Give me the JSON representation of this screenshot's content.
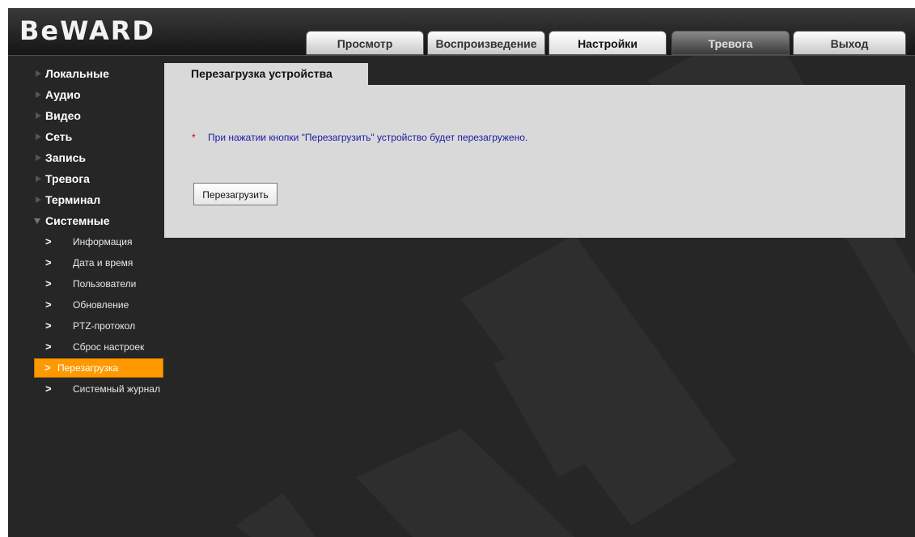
{
  "brand": {
    "logo": "BeWARD"
  },
  "tabs": [
    {
      "label": "Просмотр"
    },
    {
      "label": "Воспроизведение"
    },
    {
      "label": "Настройки",
      "active": true
    },
    {
      "label": "Тревога"
    },
    {
      "label": "Выход"
    }
  ],
  "sidebar": {
    "categories": [
      {
        "label": "Локальные"
      },
      {
        "label": "Аудио"
      },
      {
        "label": "Видео"
      },
      {
        "label": "Сеть"
      },
      {
        "label": "Запись"
      },
      {
        "label": "Тревога"
      },
      {
        "label": "Терминал"
      },
      {
        "label": "Системные",
        "expanded": true
      }
    ],
    "system_items": [
      {
        "label": "Информация"
      },
      {
        "label": "Дата и время"
      },
      {
        "label": "Пользователи"
      },
      {
        "label": "Обновление"
      },
      {
        "label": "PTZ-протокол"
      },
      {
        "label": "Сброс настроек"
      },
      {
        "label": "Перезагрузка",
        "active": true
      },
      {
        "label": "Системный журнал"
      }
    ]
  },
  "content": {
    "tab_title": "Перезагрузка устройства",
    "note_marker": "*",
    "note": "При нажатии кнопки \"Перезагрузить\" устройство будет перезагружено.",
    "reboot_button": "Перезагрузить"
  },
  "colors": {
    "background": "#262626",
    "panel": "#d9d9d9",
    "accent_active": "#ff9900",
    "note_text": "#1a1aa8",
    "required_marker": "#d40000"
  },
  "icons": {
    "category_arrow": "triangle-right-icon",
    "expanded_arrow": "triangle-down-icon",
    "sub_item": "chevron-right-icon"
  }
}
